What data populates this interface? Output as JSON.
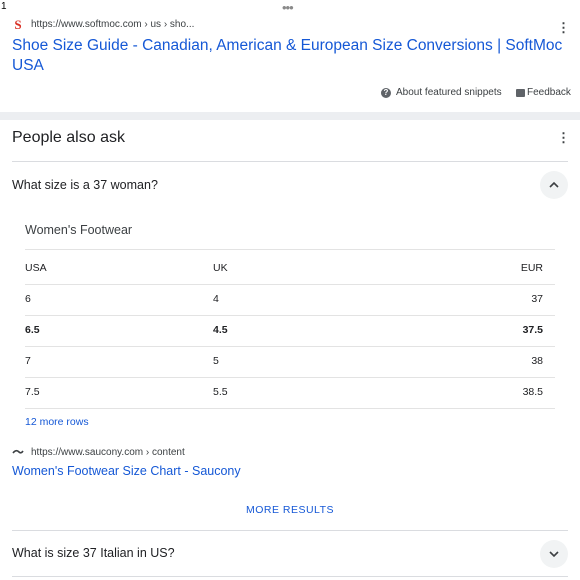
{
  "page_number": "1",
  "featured_snippet": {
    "source_url": "https://www.softmoc.com › us › sho...",
    "title": "Shoe Size Guide - Canadian, American & European Size Conversions | SoftMoc USA",
    "about_label": "About featured snippets",
    "feedback_label": "Feedback"
  },
  "people_also_ask": {
    "heading": "People also ask",
    "questions": [
      {
        "text": "What size is a 37 woman?",
        "expanded": true,
        "answer": {
          "table_title": "Women's Footwear",
          "columns": [
            "USA",
            "UK",
            "EUR"
          ],
          "rows": [
            [
              "6",
              "4",
              "37"
            ],
            [
              "6.5",
              "4.5",
              "37.5"
            ],
            [
              "7",
              "5",
              "38"
            ],
            [
              "7.5",
              "5.5",
              "38.5"
            ]
          ],
          "more_rows_label": "12 more rows",
          "source_url": "https://www.saucony.com › content",
          "source_title": "Women's Footwear Size Chart - Saucony"
        }
      },
      {
        "text": "What is size 37 Italian in US?",
        "expanded": false
      }
    ],
    "more_results_label": "MORE RESULTS"
  },
  "colors": {
    "link": "#1558d6",
    "favicon": "#d93025",
    "band": "#eceef1"
  }
}
